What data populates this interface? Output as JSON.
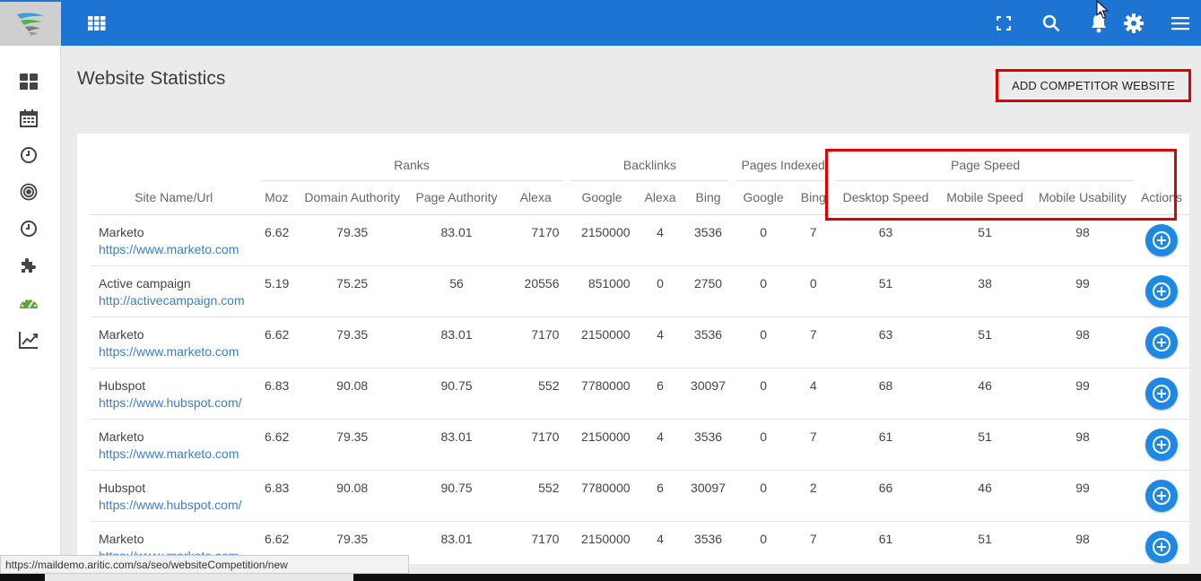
{
  "header": {
    "icons": [
      "grid-icon",
      "fullscreen-icon",
      "search-icon",
      "bell-icon",
      "gear-icon",
      "menu-icon"
    ]
  },
  "sidebar": {
    "icons": [
      "dashboard-icon",
      "calendar-icon",
      "clock-icon",
      "target-icon",
      "history-icon",
      "puzzle-icon",
      "speedometer-icon",
      "trend-chart-icon"
    ],
    "active_color": "#5aa832"
  },
  "page": {
    "title": "Website Statistics",
    "add_button": "ADD COMPETITOR WEBSITE"
  },
  "table": {
    "groups": {
      "ranks": "Ranks",
      "backlinks": "Backlinks",
      "pages_indexed": "Pages Indexed",
      "page_speed": "Page Speed"
    },
    "columns": {
      "site": "Site Name/Url",
      "moz": "Moz",
      "domain_authority": "Domain Authority",
      "page_authority": "Page Authority",
      "alexa_rank": "Alexa",
      "google_backlinks": "Google",
      "alexa_backlinks": "Alexa",
      "bing_backlinks": "Bing",
      "google_indexed": "Google",
      "bing_indexed": "Bing",
      "desktop_speed": "Desktop Speed",
      "mobile_speed": "Mobile Speed",
      "mobile_usability": "Mobile Usability",
      "actions": "Actions"
    },
    "rows": [
      {
        "name": "Marketo",
        "url": "https://www.marketo.com",
        "moz": "6.62",
        "da": "79.35",
        "pa": "83.01",
        "alexa": "7170",
        "gb": "2150000",
        "ab": "4",
        "bb": "3536",
        "gi": "0",
        "bi": "7",
        "ds": "63",
        "ms": "51",
        "mu": "98"
      },
      {
        "name": "Active campaign",
        "url": "http://activecampaign.com",
        "moz": "5.19",
        "da": "75.25",
        "pa": "56",
        "alexa": "20556",
        "gb": "851000",
        "ab": "0",
        "bb": "2750",
        "gi": "0",
        "bi": "0",
        "ds": "51",
        "ms": "38",
        "mu": "99"
      },
      {
        "name": "Marketo",
        "url": "https://www.marketo.com",
        "moz": "6.62",
        "da": "79.35",
        "pa": "83.01",
        "alexa": "7170",
        "gb": "2150000",
        "ab": "4",
        "bb": "3536",
        "gi": "0",
        "bi": "7",
        "ds": "63",
        "ms": "51",
        "mu": "98"
      },
      {
        "name": "Hubspot",
        "url": "https://www.hubspot.com/",
        "moz": "6.83",
        "da": "90.08",
        "pa": "90.75",
        "alexa": "552",
        "gb": "7780000",
        "ab": "6",
        "bb": "30097",
        "gi": "0",
        "bi": "4",
        "ds": "68",
        "ms": "46",
        "mu": "99"
      },
      {
        "name": "Marketo",
        "url": "https://www.marketo.com",
        "moz": "6.62",
        "da": "79.35",
        "pa": "83.01",
        "alexa": "7170",
        "gb": "2150000",
        "ab": "4",
        "bb": "3536",
        "gi": "0",
        "bi": "7",
        "ds": "61",
        "ms": "51",
        "mu": "98"
      },
      {
        "name": "Hubspot",
        "url": "https://www.hubspot.com/",
        "moz": "6.83",
        "da": "90.08",
        "pa": "90.75",
        "alexa": "552",
        "gb": "7780000",
        "ab": "6",
        "bb": "30097",
        "gi": "0",
        "bi": "2",
        "ds": "66",
        "ms": "46",
        "mu": "99"
      },
      {
        "name": "Marketo",
        "url": "https://www.marketo.com",
        "moz": "6.62",
        "da": "79.35",
        "pa": "83.01",
        "alexa": "7170",
        "gb": "2150000",
        "ab": "4",
        "bb": "3536",
        "gi": "0",
        "bi": "7",
        "ds": "61",
        "ms": "51",
        "mu": "98"
      }
    ]
  },
  "status_bar": {
    "url": "https://maildemo.aritic.com/sa/seo/websiteCompetition/new"
  },
  "colors": {
    "topbar": "#1e74d3",
    "highlight": "#e00000",
    "link": "#3b7ec9",
    "action_button": "#1e88e5"
  }
}
